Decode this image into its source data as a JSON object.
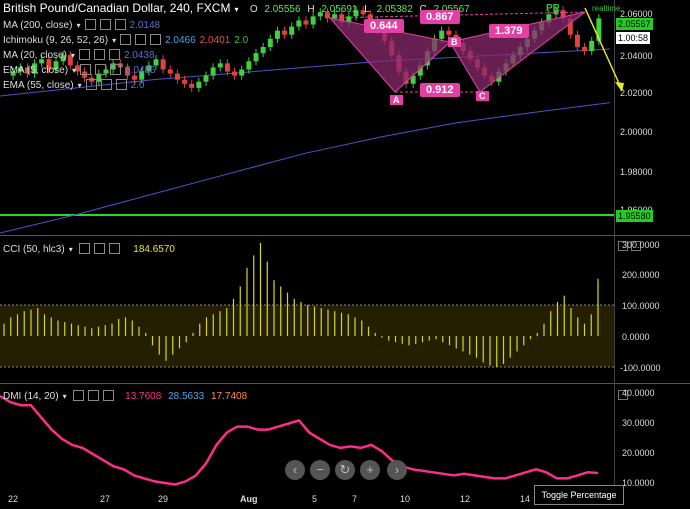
{
  "header": {
    "title": "British Pound/Canadian Dollar, 240, FXCM",
    "ohlc": {
      "o_label": "O",
      "o": "2.05556",
      "h_label": "H",
      "h": "2.05691",
      "l_label": "L",
      "l": "2.05382",
      "c_label": "C",
      "c": "2.05567"
    }
  },
  "indicators": [
    {
      "label": "MA (200, close)",
      "values": [
        "2.0148"
      ],
      "colors": [
        "#5b6fd6"
      ]
    },
    {
      "label": "Ichimoku (9, 26, 52, 26)",
      "values": [
        "2.0466",
        "2.0401",
        "2.0"
      ],
      "colors": [
        "#4aa3df",
        "#e05050",
        "#3fbf3f"
      ]
    },
    {
      "label": "MA (20, close)",
      "values": [
        "2.0438"
      ],
      "colors": [
        "#5b6fd6"
      ]
    },
    {
      "label": "EMA (5, close)",
      "values": [
        "2.0485"
      ],
      "colors": [
        "#5b6fd6"
      ]
    },
    {
      "label": "EMA (55, close)",
      "values": [
        "2.0"
      ],
      "colors": [
        "#5b6fd6"
      ]
    }
  ],
  "pattern": {
    "ratios": [
      "0.644",
      "0.867",
      "1.379",
      "0.912"
    ],
    "points": [
      "A",
      "B",
      "C"
    ]
  },
  "price_axis": {
    "ticks": [
      "2.06000",
      "2.04000",
      "2.02000",
      "2.00000",
      "1.98000",
      "1.96000"
    ],
    "current_top": "2.05567",
    "current_bottom": "1.00:58",
    "support_level": "1.95580",
    "label_pr": "PR",
    "label_live": "realtime"
  },
  "cci": {
    "label": "CCI (50, hlc3)",
    "value": "184.6570",
    "ticks": [
      "300.0000",
      "200.0000",
      "100.0000",
      "0.0000",
      "-100.0000"
    ]
  },
  "dmi": {
    "label": "DMI (14, 20)",
    "values": [
      "13.7608",
      "28.5633",
      "17.7408"
    ],
    "ticks": [
      "40.0000",
      "30.0000",
      "20.0000",
      "10.0000"
    ]
  },
  "x_axis": {
    "labels": [
      "22",
      "27",
      "29",
      "Aug",
      "5",
      "7",
      "10",
      "12",
      "14"
    ]
  },
  "controls": {
    "toggle_label": "Toggle Percentage"
  },
  "chart_data": [
    {
      "type": "line",
      "title": "British Pound/Canadian Dollar, 240, FXCM",
      "series": [
        {
          "name": "MA (200, close)",
          "values": [
            1.951,
            1.96,
            1.97,
            1.98,
            1.99,
            1.998,
            2.005,
            2.01,
            2.0148
          ]
        },
        {
          "name": "EMA (55, close)",
          "values": [
            2.018,
            2.022,
            2.026,
            2.029,
            2.032,
            2.035,
            2.037,
            2.039,
            2.041
          ]
        }
      ],
      "categories": [
        "22",
        "27",
        "29",
        "Aug",
        "5",
        "7",
        "10",
        "12",
        "14"
      ],
      "ylim": [
        1.95,
        2.065
      ]
    },
    {
      "type": "bar",
      "title": "CCI (50, hlc3)",
      "ylim": [
        -100,
        300
      ],
      "values": [
        40,
        60,
        70,
        80,
        85,
        90,
        70,
        60,
        50,
        45,
        40,
        35,
        30,
        25,
        30,
        35,
        40,
        55,
        60,
        50,
        30,
        10,
        -30,
        -60,
        -80,
        -60,
        -40,
        -20,
        10,
        40,
        60,
        70,
        80,
        90,
        120,
        160,
        220,
        260,
        300,
        240,
        180,
        160,
        140,
        120,
        110,
        100,
        95,
        90,
        85,
        80,
        75,
        70,
        60,
        50,
        30,
        10,
        -5,
        -15,
        -20,
        -25,
        -30,
        -25,
        -20,
        -15,
        -10,
        -20,
        -30,
        -40,
        -50,
        -60,
        -70,
        -85,
        -95,
        -100,
        -90,
        -70,
        -50,
        -30,
        -10,
        10,
        40,
        80,
        110,
        130,
        90,
        60,
        40,
        70,
        184.657
      ]
    },
    {
      "type": "line",
      "title": "DMI (14, 20)",
      "ylim": [
        8,
        42
      ],
      "series": [
        {
          "name": "DMI",
          "values": [
            39,
            37,
            36,
            36,
            32,
            28,
            25,
            23,
            22,
            20,
            18,
            16,
            15,
            13,
            12,
            11,
            10.5,
            10,
            11,
            13,
            17,
            23,
            27,
            29,
            29,
            28,
            28,
            29,
            30,
            31,
            27,
            25,
            23,
            22,
            22.5,
            22,
            23,
            21,
            18,
            16,
            15,
            14.5,
            14,
            13.5,
            13,
            13.5,
            13,
            12.5,
            12,
            12,
            13,
            14,
            15,
            14,
            12,
            12,
            13,
            14,
            13.7608
          ]
        }
      ]
    }
  ]
}
